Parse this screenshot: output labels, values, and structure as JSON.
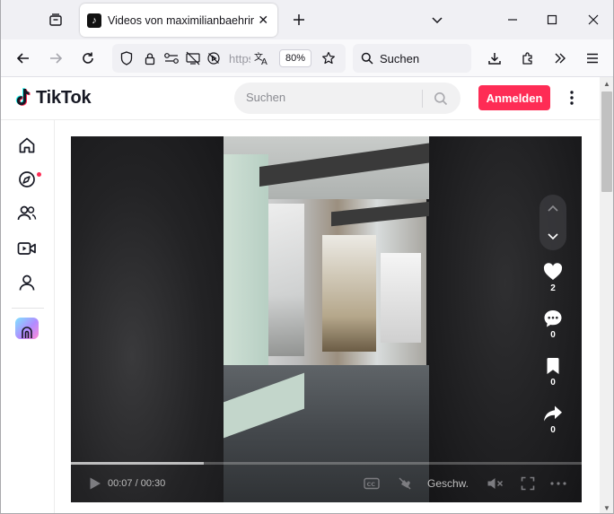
{
  "browser": {
    "tab_title": "Videos von maximilianbaehring",
    "url_text": "https",
    "zoom": "80%",
    "search_label": "Suchen"
  },
  "tiktok": {
    "logo_text": "TikTok",
    "search_placeholder": "Suchen",
    "login_label": "Anmelden",
    "accent_color": "#fe2c55"
  },
  "video": {
    "likes": "2",
    "comments": "0",
    "saves": "0",
    "shares": "0",
    "time_current": "00:07",
    "time_total": "00:30",
    "time_display": "00:07 / 00:30",
    "progress": 0.26,
    "speed_label": "Geschw."
  }
}
